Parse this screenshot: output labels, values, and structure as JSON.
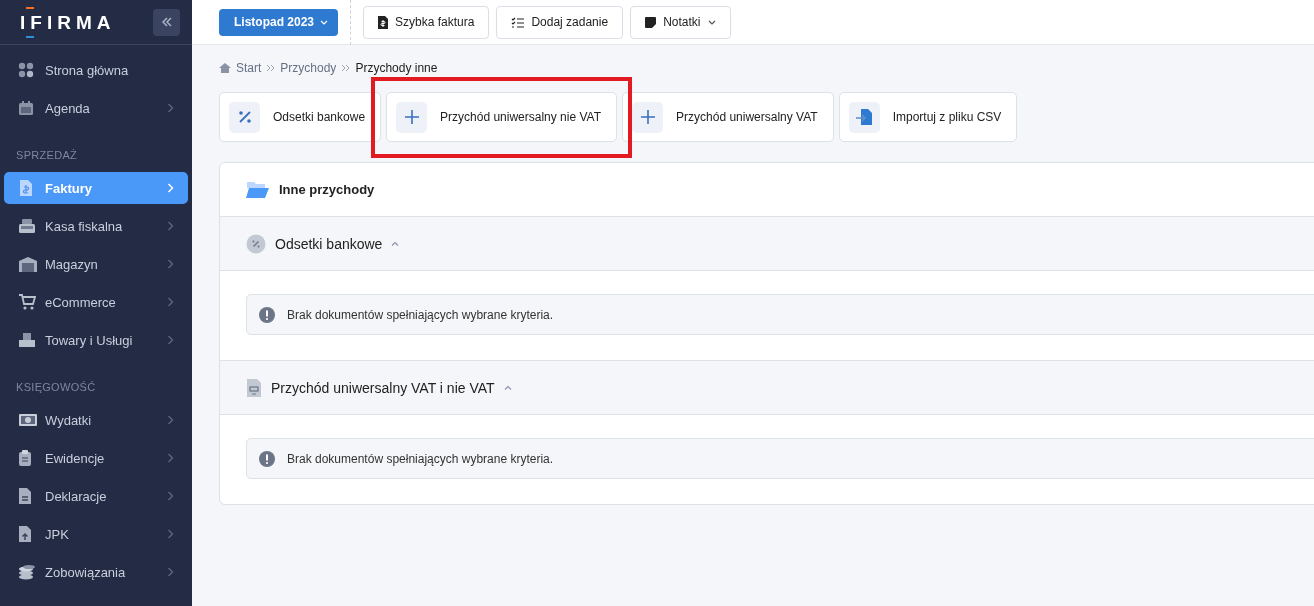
{
  "sidebar": {
    "logo": "IFIRMA",
    "items": [
      {
        "kind": "item",
        "label": "Strona główna",
        "has_submenu": false,
        "selected": false
      },
      {
        "kind": "item",
        "label": "Agenda",
        "has_submenu": true,
        "selected": false
      },
      {
        "kind": "heading",
        "label": "SPRZEDAŻ"
      },
      {
        "kind": "item",
        "label": "Faktury",
        "has_submenu": true,
        "selected": true
      },
      {
        "kind": "item",
        "label": "Kasa fiskalna",
        "has_submenu": true,
        "selected": false
      },
      {
        "kind": "item",
        "label": "Magazyn",
        "has_submenu": true,
        "selected": false
      },
      {
        "kind": "item",
        "label": "eCommerce",
        "has_submenu": true,
        "selected": false
      },
      {
        "kind": "item",
        "label": "Towary i Usługi",
        "has_submenu": true,
        "selected": false
      },
      {
        "kind": "heading",
        "label": "KSIĘGOWOŚĆ"
      },
      {
        "kind": "item",
        "label": "Wydatki",
        "has_submenu": true,
        "selected": false
      },
      {
        "kind": "item",
        "label": "Ewidencje",
        "has_submenu": true,
        "selected": false
      },
      {
        "kind": "item",
        "label": "Deklaracje",
        "has_submenu": true,
        "selected": false
      },
      {
        "kind": "item",
        "label": "JPK",
        "has_submenu": true,
        "selected": false
      },
      {
        "kind": "item",
        "label": "Zobowiązania",
        "has_submenu": true,
        "selected": false
      }
    ]
  },
  "topbar": {
    "period": "Listopad 2023",
    "buttons": [
      {
        "label": "Szybka faktura",
        "dropdown": false
      },
      {
        "label": "Dodaj zadanie",
        "dropdown": false
      },
      {
        "label": "Notatki",
        "dropdown": true
      }
    ]
  },
  "breadcrumb": [
    {
      "label": "Start",
      "current": false
    },
    {
      "label": "Przychody",
      "current": false
    },
    {
      "label": "Przychody inne",
      "current": true
    }
  ],
  "actions": [
    {
      "label": "Odsetki bankowe",
      "highlighted": false
    },
    {
      "label": "Przychód uniwersalny nie VAT",
      "highlighted": true
    },
    {
      "label": "Przychód uniwersalny VAT",
      "highlighted": false
    },
    {
      "label": "Importuj z pliku CSV",
      "highlighted": false
    }
  ],
  "panel": {
    "title": "Inne przychody",
    "sections": [
      {
        "title": "Odsetki bankowe",
        "expanded": true,
        "message": "Brak dokumentów spełniających wybrane kryteria."
      },
      {
        "title": "Przychód uniwersalny VAT i nie VAT",
        "expanded": true,
        "message": "Brak dokumentów spełniających wybrane kryteria."
      }
    ]
  }
}
